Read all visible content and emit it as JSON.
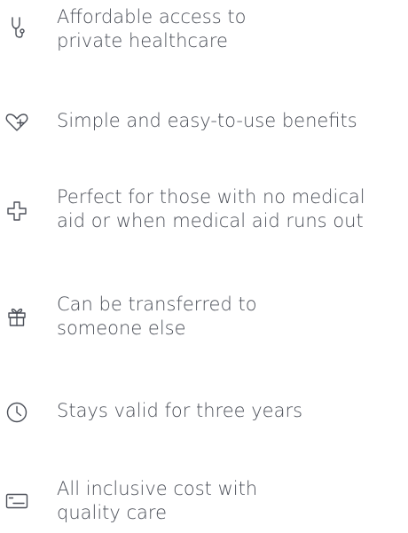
{
  "benefits": [
    {
      "icon": "stethoscope-icon",
      "text": "Affordable access to\nprivate healthcare"
    },
    {
      "icon": "heart-plus-icon",
      "text": "Simple and easy-to-use benefits"
    },
    {
      "icon": "medical-cross-icon",
      "text": "Perfect for those with no medical\naid or when medical aid runs out"
    },
    {
      "icon": "gift-icon",
      "text": "Can be transferred to\nsomeone else"
    },
    {
      "icon": "clock-icon",
      "text": "Stays valid for three years"
    },
    {
      "icon": "card-icon",
      "text": "All inclusive cost with\nquality care"
    }
  ],
  "colors": {
    "text": "#4b4f58",
    "icon": "#4b4f58"
  }
}
